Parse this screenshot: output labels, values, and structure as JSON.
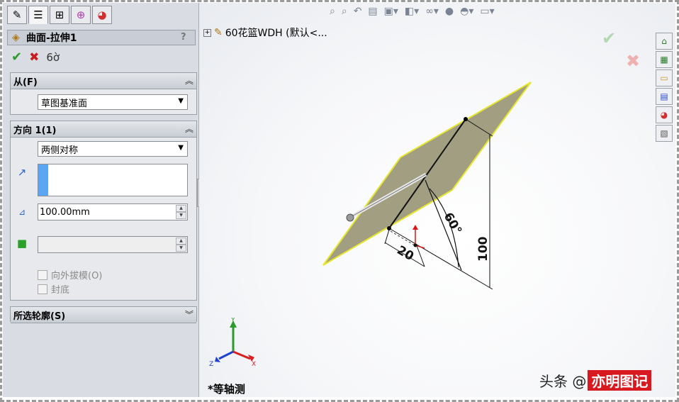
{
  "property_manager": {
    "tabs": [
      "feature-manager",
      "property-manager",
      "configuration-manager",
      "dimxpert-manager",
      "display-manager"
    ],
    "title": "曲面-拉伸1",
    "help": "?",
    "from_group": {
      "title": "从(F)",
      "select_value": "草图基准面"
    },
    "direction_group": {
      "title": "方向 1(1)",
      "end_condition": "两侧对称",
      "depth": "100.00mm",
      "draft_label": "向外拔模(O)",
      "cap_label": "封底"
    },
    "contours_group": {
      "title": "所选轮廓(S)"
    }
  },
  "graphics": {
    "tree_item": "60花篮WDH  (默认<...",
    "view_name": "*等轴测",
    "dimension_angle": "60°",
    "dimension_width": "20",
    "dimension_height": "100",
    "triad": {
      "x": "X",
      "y": "Y",
      "z": "Z"
    },
    "colors": {
      "surface": "#a29e82",
      "edge": "#e6e62e",
      "accent": "#d8191f"
    }
  },
  "watermark": {
    "prefix": "头条 @",
    "brand": "亦明图记"
  }
}
